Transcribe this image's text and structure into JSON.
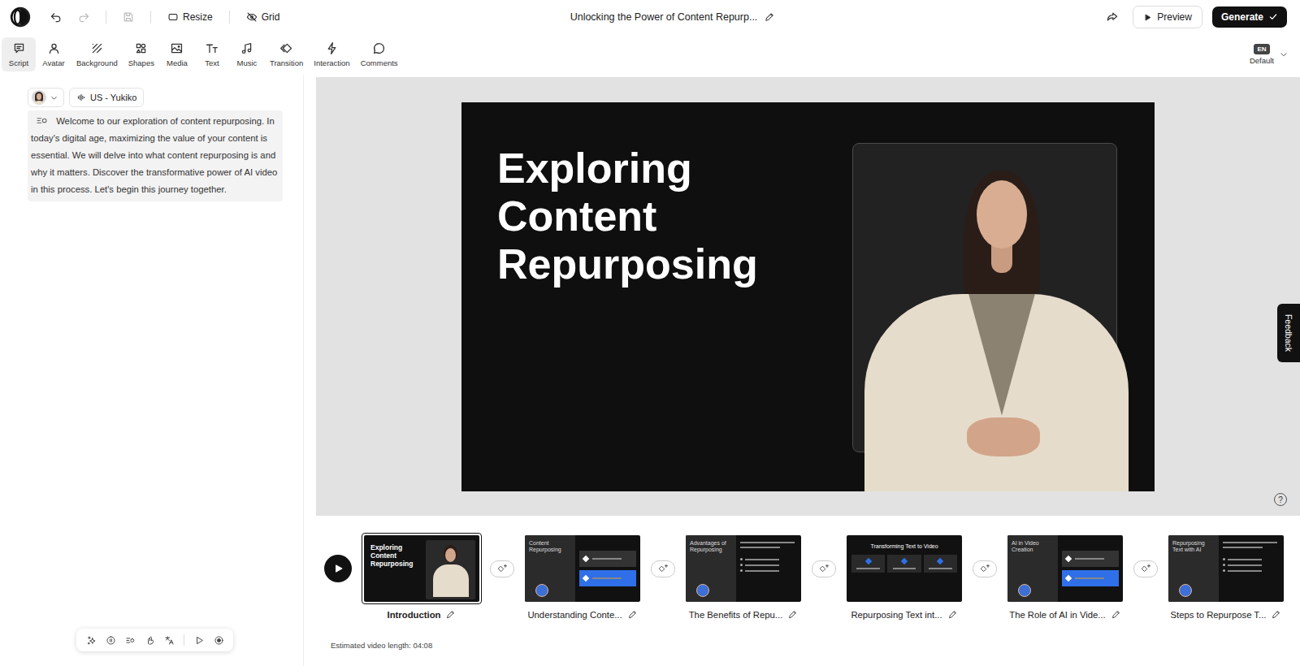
{
  "topbar": {
    "title": "Unlocking the Power of Content Repurp...",
    "resize": "Resize",
    "grid": "Grid",
    "preview": "Preview",
    "generate": "Generate",
    "undo_disabled": false,
    "redo_disabled": true
  },
  "tools": [
    {
      "label": "Script",
      "selected": true
    },
    {
      "label": "Avatar",
      "selected": false
    },
    {
      "label": "Background",
      "selected": false
    },
    {
      "label": "Shapes",
      "selected": false
    },
    {
      "label": "Media",
      "selected": false
    },
    {
      "label": "Text",
      "selected": false
    },
    {
      "label": "Music",
      "selected": false
    },
    {
      "label": "Transition",
      "selected": false
    },
    {
      "label": "Interaction",
      "selected": false
    },
    {
      "label": "Comments",
      "selected": false
    }
  ],
  "language": {
    "code": "EN",
    "label": "Default"
  },
  "script": {
    "voice": "US - Yukiko",
    "text": "Welcome to our exploration of content repurposing. In today's digital age, maximizing the value of your content is essential. We will delve into what content repurposing is and why it matters. Discover the transformative power of AI video in this process. Let's begin this journey together."
  },
  "slide": {
    "title": "Exploring Content Repurposing"
  },
  "feedback": "Feedback",
  "help": "?",
  "timeline": {
    "scenes": [
      {
        "label": "Introduction",
        "selected": true,
        "kind": "title",
        "heading": "Exploring Content Repurposing"
      },
      {
        "label": "Understanding Conte...",
        "selected": false,
        "kind": "cards",
        "heading": "Content Repurposing"
      },
      {
        "label": "The Benefits of Repu...",
        "selected": false,
        "kind": "bullets",
        "heading": "Advantages of Repurposing"
      },
      {
        "label": "Repurposing Text int...",
        "selected": false,
        "kind": "columns",
        "heading": "Transforming Text to Video"
      },
      {
        "label": "The Role of AI in Vide...",
        "selected": false,
        "kind": "cards",
        "heading": "AI in Video Creation"
      },
      {
        "label": "Steps to Repurpose T...",
        "selected": false,
        "kind": "bullets",
        "heading": "Repurposing Text with AI"
      }
    ],
    "estimate": "Estimated video length: 04:08"
  }
}
